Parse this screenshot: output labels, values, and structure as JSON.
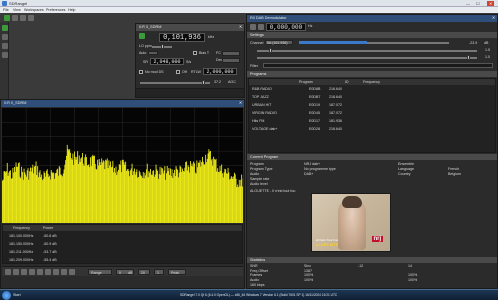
{
  "app": {
    "title": "SDRangel",
    "window_controls": [
      "—",
      "☐",
      "✕"
    ],
    "menu": [
      "File",
      "View",
      "Workspaces",
      "Preferences",
      "Help"
    ]
  },
  "device_panel": {
    "title": "0:R 0_SDRM",
    "frequency": "0,101,936",
    "freq_unit": "kHz",
    "label_1": "LO ppm",
    "label_2": "Auto",
    "label_3": "Bias T",
    "label_4": "FC",
    "label_5": "Dec",
    "sr_label": "SR",
    "sample_rate": "2,048,000",
    "sr_unit": "S/s",
    "label_6": "No mod DS",
    "label_7": "Off",
    "label_8": "RTLW",
    "rate_2": "2,000,000",
    "gain_value": "37.2",
    "agc_label": "AGC"
  },
  "channel_panel": {
    "title": "R0 DAB Demodulator",
    "frequency": "0,000,000",
    "freq_unit": "Hz",
    "channel_label": "Channel",
    "channel_value": "5A (161.936)",
    "level": "-23.9",
    "level_unit": "dB",
    "filter_label": "Filter",
    "value_2": "1.5",
    "value_3": "1.0"
  },
  "settings_header": "Settings",
  "programs": {
    "header": "Programs",
    "columns": [
      "Program",
      "ID",
      "Frequency"
    ],
    "rows": [
      [
        "R&B RADIO",
        "E0D8B",
        "218.640"
      ],
      [
        "TOP JAZZ",
        "E0DB7",
        "218.640"
      ],
      [
        "URBAN HIT",
        "E0D19",
        "187.072"
      ],
      [
        "VIRGIN RADIO",
        "E0D45",
        "187.072"
      ],
      [
        "Hits FM",
        "E0D17",
        "181.936"
      ],
      [
        "VOLTAGE dab+",
        "E0D28",
        "218.640"
      ]
    ]
  },
  "current_program": {
    "header": "Current Program",
    "left_labels": [
      "Program",
      "Program Type",
      "Audio",
      "Sample rate",
      "Audio level"
    ],
    "left_values": [
      "NRJ dab+",
      "No programme type",
      "DAB+",
      "",
      ""
    ],
    "right_labels": [
      "Ensemble",
      "Language",
      "Country"
    ],
    "right_values": [
      "",
      "French",
      "Belgium"
    ],
    "now_playing": "ALOUETTE - Il n'est tout fou",
    "art_text_1": "El Dark Tout Fou",
    "art_text_2": "ALIZÉE HITS",
    "art_logo": "nrj"
  },
  "statistics": {
    "header": "Statistics",
    "rows": [
      [
        "SNR",
        "Sinc",
        "",
        "-12",
        "",
        "14"
      ],
      [
        "Freq Offset",
        "",
        "",
        "1387",
        "",
        ""
      ],
      [
        "Frames",
        "",
        "",
        "100%",
        "",
        "100%"
      ],
      [
        "Audio",
        "",
        "",
        "100%",
        "",
        "100%"
      ]
    ],
    "rate": "160 kbps"
  },
  "spectrum_panel": {
    "title": "0:R 0_SDRM",
    "columns": [
      "Frequency",
      "Power"
    ],
    "rows": [
      [
        "181.100.000Hz",
        "-50.8 dB"
      ],
      [
        "181.150.000Hz",
        "-50.9 dB"
      ],
      [
        "181.211.000Hz",
        "-53.7 dB"
      ],
      [
        "181.209.000Hz",
        "-55.4 dB"
      ]
    ],
    "range_label": "Range",
    "ref_value": "0",
    "ref_unit": "dB",
    "fps_value": "20",
    "avg_value": "1",
    "mode_label": "Peak"
  },
  "spectrum": {
    "fill_color": "#e9e61a",
    "mask_x": [
      0,
      2,
      4,
      6,
      8,
      10,
      12,
      14,
      16,
      18,
      20,
      22,
      25,
      27,
      30,
      32,
      35,
      37,
      40,
      42,
      45,
      47,
      50,
      52,
      55,
      57,
      60,
      62,
      65,
      67,
      70,
      72,
      75,
      77,
      80,
      82,
      85,
      87,
      90,
      92,
      95,
      97,
      100
    ],
    "mask_y": [
      0.6,
      0.74,
      0.66,
      0.78,
      0.7,
      0.68,
      0.72,
      0.76,
      0.66,
      0.64,
      0.7,
      0.68,
      0.74,
      0.96,
      0.86,
      0.9,
      0.82,
      0.84,
      0.78,
      0.8,
      0.76,
      0.74,
      0.78,
      0.72,
      0.75,
      0.7,
      0.73,
      0.72,
      0.71,
      0.69,
      0.7,
      0.72,
      0.7,
      0.78,
      0.74,
      0.8,
      0.92,
      0.88,
      0.74,
      0.72,
      0.66,
      0.6,
      0.6
    ]
  },
  "taskbar": {
    "start_label": "Start",
    "status": "SDRangel 7.0 Qt 6 (6.4.0 OpenGL) — x86_64 Windows 7 Version 6.1 (Build 7601 SP 1) 16/11/2024 15:21 UTC"
  },
  "accent_color": "#3c78c8"
}
